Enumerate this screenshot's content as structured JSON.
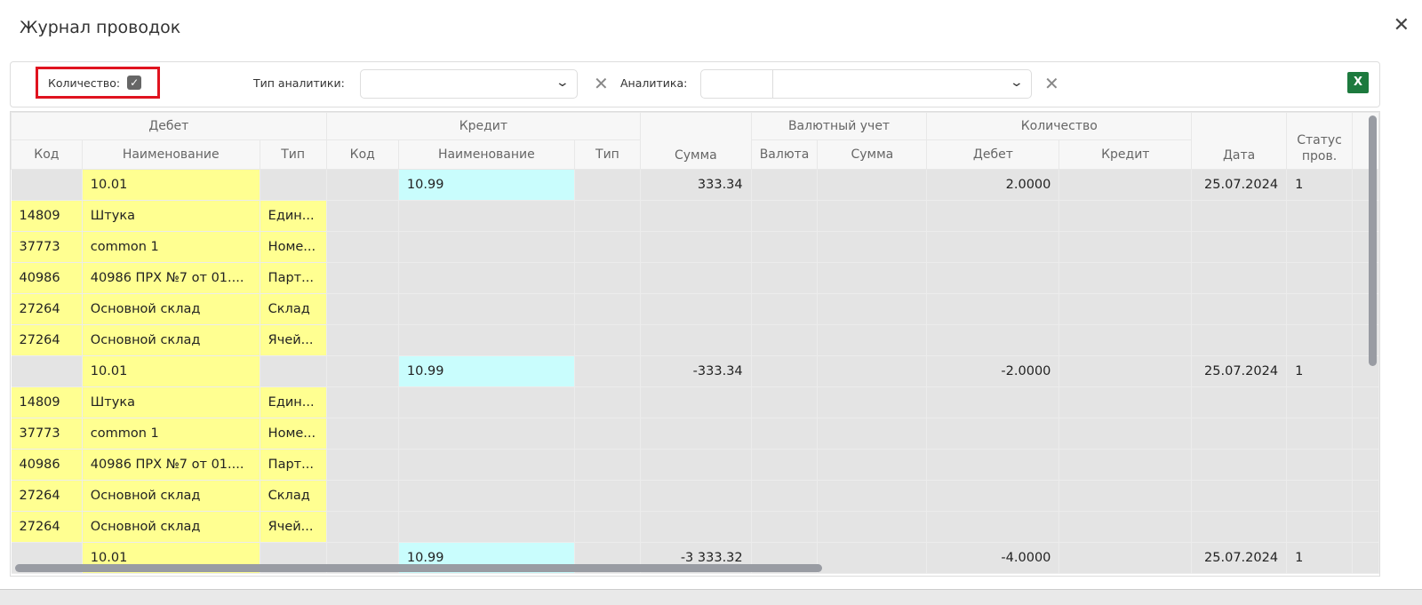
{
  "window": {
    "title": "Журнал проводок",
    "close": "✕"
  },
  "toolbar": {
    "quantity_label": "Количество:",
    "quantity_checked": true,
    "analytics_type_label": "Тип аналитики:",
    "analytics_type_value": "",
    "analytics_label": "Аналитика:",
    "analytics_code": "",
    "analytics_value": "",
    "export_label": "X"
  },
  "columns": {
    "group_debit": "Дебет",
    "group_credit": "Кредит",
    "group_currency": "Валютный учет",
    "group_quantity": "Количество",
    "code": "Код",
    "name": "Наименование",
    "type": "Тип",
    "sum": "Сумма",
    "currency": "Валюта",
    "qdebit": "Дебет",
    "qcredit": "Кредит",
    "date": "Дата",
    "status": "Статус пров."
  },
  "rows": [
    {
      "kind": "entry",
      "debit_name": "10.01",
      "credit_name": "10.99",
      "sum": "333.34",
      "q_debit": "2.0000",
      "date": "25.07.2024",
      "status": "1"
    },
    {
      "kind": "analytic",
      "code": "14809",
      "name": "Штука",
      "type": "Един..."
    },
    {
      "kind": "analytic",
      "code": "37773",
      "name": "common 1",
      "type": "Номе..."
    },
    {
      "kind": "analytic",
      "code": "40986",
      "name": "40986 ПРХ №7 от 01....",
      "type": "Парт..."
    },
    {
      "kind": "analytic",
      "code": "27264",
      "name": "Основной склад",
      "type": "Склад"
    },
    {
      "kind": "analytic",
      "code": "27264",
      "name": "Основной склад",
      "type": "Ячей..."
    },
    {
      "kind": "entry",
      "debit_name": "10.01",
      "credit_name": "10.99",
      "sum": "-333.34",
      "q_debit": "-2.0000",
      "date": "25.07.2024",
      "status": "1"
    },
    {
      "kind": "analytic",
      "code": "14809",
      "name": "Штука",
      "type": "Един..."
    },
    {
      "kind": "analytic",
      "code": "37773",
      "name": "common 1",
      "type": "Номе..."
    },
    {
      "kind": "analytic",
      "code": "40986",
      "name": "40986 ПРХ №7 от 01....",
      "type": "Парт..."
    },
    {
      "kind": "analytic",
      "code": "27264",
      "name": "Основной склад",
      "type": "Склад"
    },
    {
      "kind": "analytic",
      "code": "27264",
      "name": "Основной склад",
      "type": "Ячей..."
    },
    {
      "kind": "entry",
      "debit_name": "10.01",
      "credit_name": "10.99",
      "sum": "-3 333.32",
      "q_debit": "-4.0000",
      "date": "25.07.2024",
      "status": "1"
    }
  ]
}
